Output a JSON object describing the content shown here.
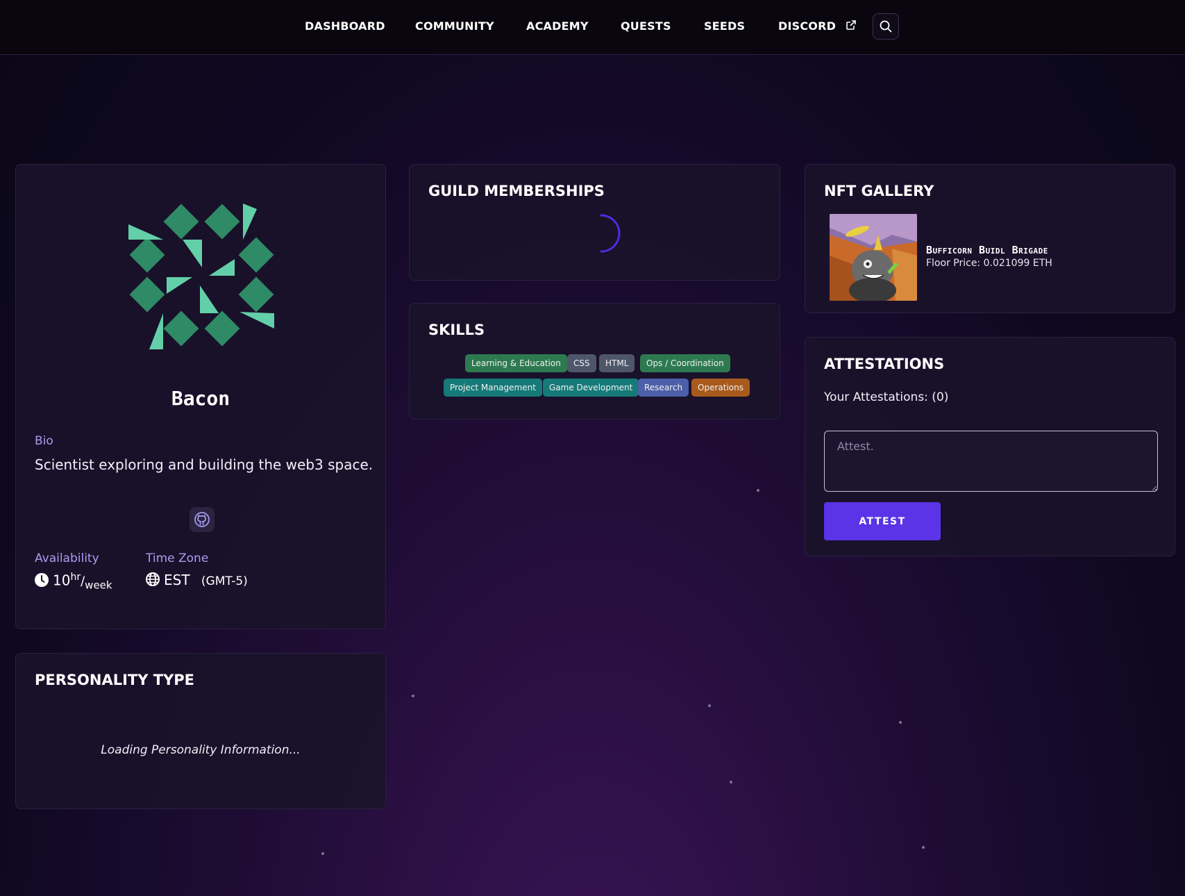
{
  "nav": {
    "items": [
      {
        "label": "DASHBOARD"
      },
      {
        "label": "COMMUNITY"
      },
      {
        "label": "ACADEMY"
      },
      {
        "label": "QUESTS"
      },
      {
        "label": "SEEDS"
      },
      {
        "label": "DISCORD",
        "icon": "external-link-icon"
      }
    ],
    "search_icon": "search-icon"
  },
  "profile": {
    "name": "Bacon",
    "avatar_icon": "identicon-avatar",
    "bio_label": "Bio",
    "bio": "Scientist exploring and building the web3 space.",
    "social_icon": "github-icon",
    "availability_label": "Availability",
    "availability_value": "10",
    "availability_unit_top": "hr",
    "availability_unit_bottom": "week",
    "timezone_label": "Time Zone",
    "timezone_abbr": "EST",
    "timezone_offset": "(GMT-5)"
  },
  "personality": {
    "title": "PERSONALITY TYPE",
    "loading": "Loading Personality Information..."
  },
  "guilds": {
    "title": "GUILD MEMBERSHIPS"
  },
  "skills": {
    "title": "SKILLS",
    "tags": [
      {
        "label": "Learning & Education",
        "color": "#2e7a50"
      },
      {
        "label": "CSS",
        "color": "#4e566a"
      },
      {
        "label": "HTML",
        "color": "#4e566a"
      },
      {
        "label": "Ops / Coordination",
        "color": "#2e7a50"
      },
      {
        "label": "Project Management",
        "color": "#157a78"
      },
      {
        "label": "Game Development",
        "color": "#157a78"
      },
      {
        "label": "Research",
        "color": "#4d5fa8"
      },
      {
        "label": "Operations",
        "color": "#a85a1c"
      }
    ]
  },
  "nft_gallery": {
    "title": "NFT GALLERY",
    "items": [
      {
        "name": "Bufficorn Buidl Brigade",
        "floor_price": "Floor Price: 0.021099 ETH"
      }
    ]
  },
  "attestations": {
    "title": "ATTESTATIONS",
    "count_label": "Your Attestations: (0)",
    "input_placeholder": "Attest.",
    "button_label": "ATTEST"
  },
  "colors": {
    "accent": "#5a34e6",
    "label": "#a89ef0",
    "identicon": "#2f8a66",
    "identicon_light": "#63cfa8"
  }
}
